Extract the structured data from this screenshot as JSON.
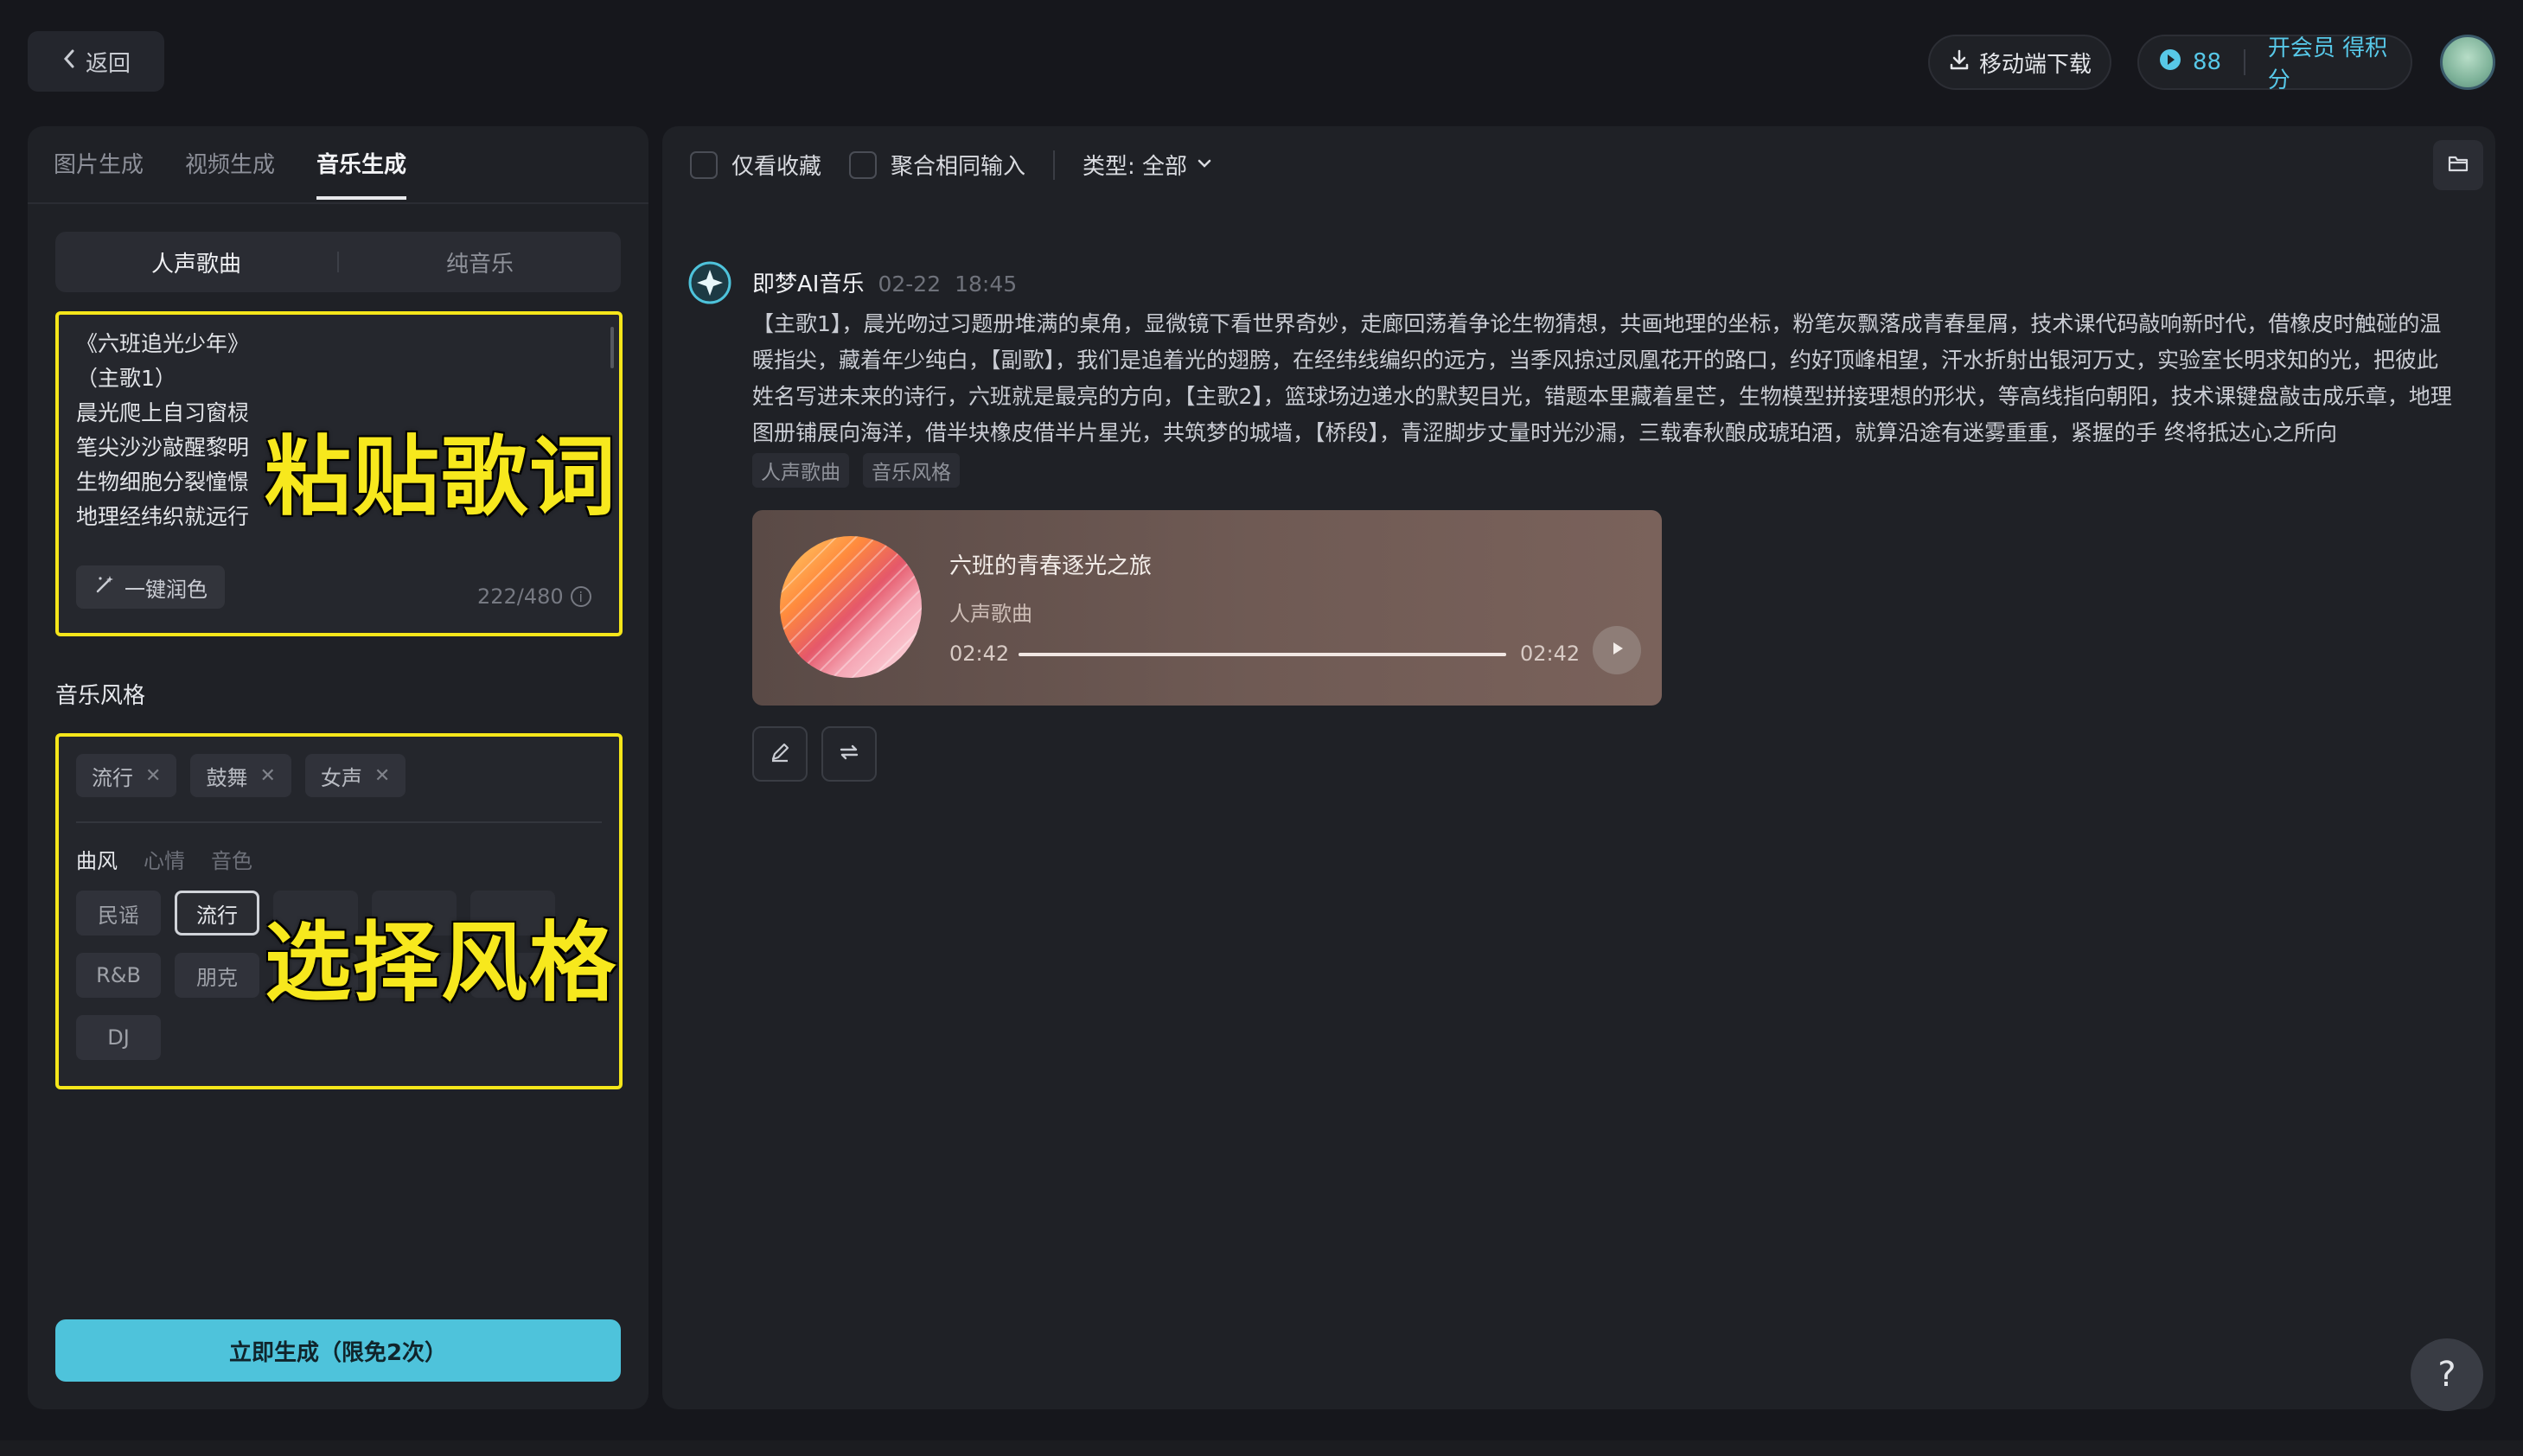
{
  "header": {
    "back_label": "返回",
    "download_label": "移动端下载",
    "points": "88",
    "vip_label": "开会员 得积分"
  },
  "left": {
    "tabs": [
      "图片生成",
      "视频生成",
      "音乐生成"
    ],
    "active_tab": "音乐生成",
    "segments": [
      "人声歌曲",
      "纯音乐"
    ],
    "lyrics": "《六班追光少年》\n（主歌1）\n晨光爬上自习窗棂\n笔尖沙沙敲醒黎明\n生物细胞分裂憧憬\n地理经纬织就远行",
    "overlay_paste": "粘贴歌词",
    "polish_label": "一键润色",
    "counter": "222/480",
    "style_title": "音乐风格",
    "selected_chips": [
      "流行",
      "鼓舞",
      "女声"
    ],
    "subtabs": [
      "曲风",
      "心情",
      "音色"
    ],
    "options": [
      "民谣",
      "流行",
      "R&B",
      "朋克",
      "DJ"
    ],
    "overlay_style": "选择风格",
    "generate_label": "立即生成（限免2次）"
  },
  "right": {
    "filter_favorites": "仅看收藏",
    "filter_merge": "聚合相同输入",
    "filter_type": "类型: 全部",
    "author": "即梦AI音乐",
    "date": "02-22",
    "time": "18:45",
    "prompt": "【主歌1】，晨光吻过习题册堆满的桌角，显微镜下看世界奇妙，走廊回荡着争论生物猜想，共画地理的坐标，粉笔灰飘落成青春星屑，技术课代码敲响新时代，借橡皮时触碰的温暖指尖，藏着年少纯白，【副歌】，我们是追着光的翅膀，在经纬线编织的远方，当季风掠过凤凰花开的路口，约好顶峰相望，汗水折射出银河万丈，实验室长明求知的光，把彼此姓名写进未来的诗行，六班就是最亮的方向，【主歌2】，篮球场边递水的默契目光，错题本里藏着星芒，生物模型拼接理想的形状，等高线指向朝阳，技术课键盘敲击成乐章，地理图册铺展向海洋，借半块橡皮借半片星光，共筑梦的城墙，【桥段】，青涩脚步丈量时光沙漏，三载春秋酿成琥珀酒，就算沿途有迷雾重重，紧握的手 终将抵达心之所向",
    "tags": [
      "人声歌曲",
      "音乐风格"
    ],
    "song_title": "六班的青春逐光之旅",
    "song_type": "人声歌曲",
    "time_current": "02:42",
    "time_total": "02:42",
    "progress": 1.0
  },
  "help_label": "?",
  "colors": {
    "accent": "#4ec3db",
    "highlight": "#f5e61a"
  }
}
